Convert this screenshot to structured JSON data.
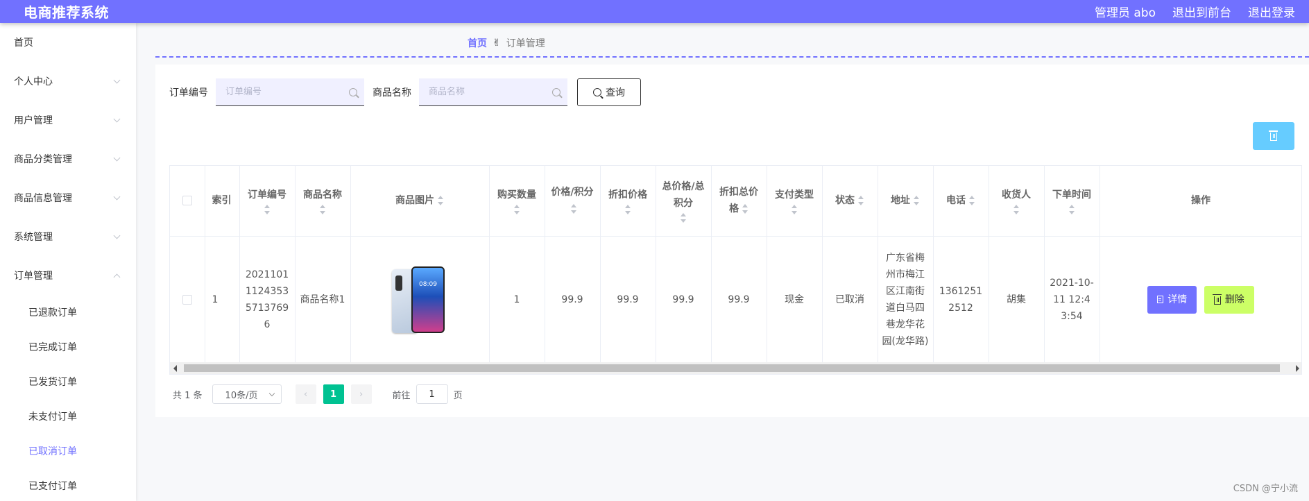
{
  "header": {
    "brand": "电商推荐系统",
    "admin": "管理员 abo",
    "to_front": "退出到前台",
    "logout": "退出登录"
  },
  "sidebar": {
    "items": [
      {
        "label": "首页"
      },
      {
        "label": "个人中心"
      },
      {
        "label": "用户管理"
      },
      {
        "label": "商品分类管理"
      },
      {
        "label": "商品信息管理"
      },
      {
        "label": "系统管理"
      },
      {
        "label": "订单管理"
      }
    ],
    "sub_items": [
      {
        "label": "已退款订单"
      },
      {
        "label": "已完成订单"
      },
      {
        "label": "已发货订单"
      },
      {
        "label": "未支付订单"
      },
      {
        "label": "已取消订单",
        "active": true
      },
      {
        "label": "已支付订单"
      }
    ]
  },
  "breadcrumb": {
    "home": "首页",
    "current": "订单管理"
  },
  "search": {
    "order_no_label": "订单编号",
    "order_no_placeholder": "订单编号",
    "order_no_value": "",
    "product_label": "商品名称",
    "product_placeholder": "商品名称",
    "product_value": "",
    "query_label": "查询"
  },
  "table": {
    "columns": [
      "索引",
      "订单编号",
      "商品名称",
      "商品图片",
      "购买数量",
      "价格/积分",
      "折扣价格",
      "总价格/总积分",
      "折扣总价格",
      "支付类型",
      "状态",
      "地址",
      "电话",
      "收货人",
      "下单时间",
      "操作"
    ],
    "row": {
      "index": "1",
      "order_no": "202110111243535713769 6",
      "product": "商品名称1",
      "phone_clock": "08:09",
      "qty": "1",
      "price": "99.9",
      "discount_price": "99.9",
      "total": "99.9",
      "discount_total": "99.9",
      "pay_type": "现金",
      "status": "已取消",
      "address": "广东省梅州市梅江区江南街道白马四巷龙华花园(龙华路)",
      "tel": "13612512512",
      "receiver": "胡集",
      "time": "2021-10-11 12:43:54",
      "detail_label": "详情",
      "delete_label": "删除"
    }
  },
  "pagination": {
    "total": "共 1 条",
    "page_size": "10条/页",
    "current_page": "1",
    "goto_prefix": "前往",
    "goto_value": "1",
    "goto_suffix": "页"
  },
  "watermark": "CSDN @宁小流",
  "colors": {
    "accent": "#7171ff",
    "batch_delete": "#66ccff",
    "delete_btn": "#ccff66",
    "active_page": "#00c292"
  }
}
